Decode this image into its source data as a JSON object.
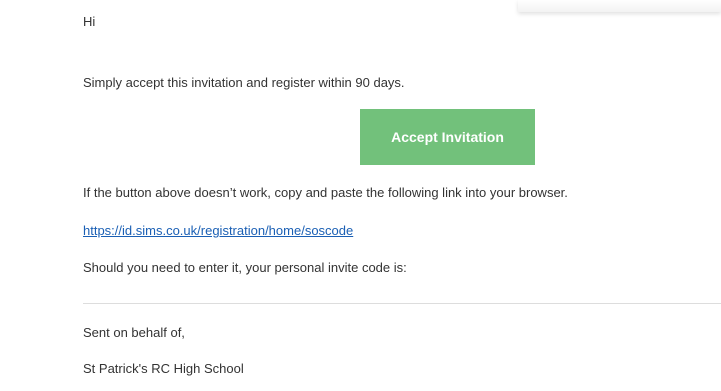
{
  "email": {
    "greeting": "Hi",
    "intro": "Simply accept this invitation and register within 90 days.",
    "accept_button": "Accept Invitation",
    "fallback_text": "If the button above doesn’t work, copy and paste the following link into your browser.",
    "link_text": "https://id.sims.co.uk/registration/home/soscode",
    "invite_code_text": "Should you need to enter it, your personal invite code is:",
    "sent_on_behalf": "Sent on behalf of,",
    "school_name": "St Patrick's RC High School"
  },
  "colors": {
    "button": "#72c17b",
    "link": "#1a5fb4",
    "text": "#333333"
  }
}
